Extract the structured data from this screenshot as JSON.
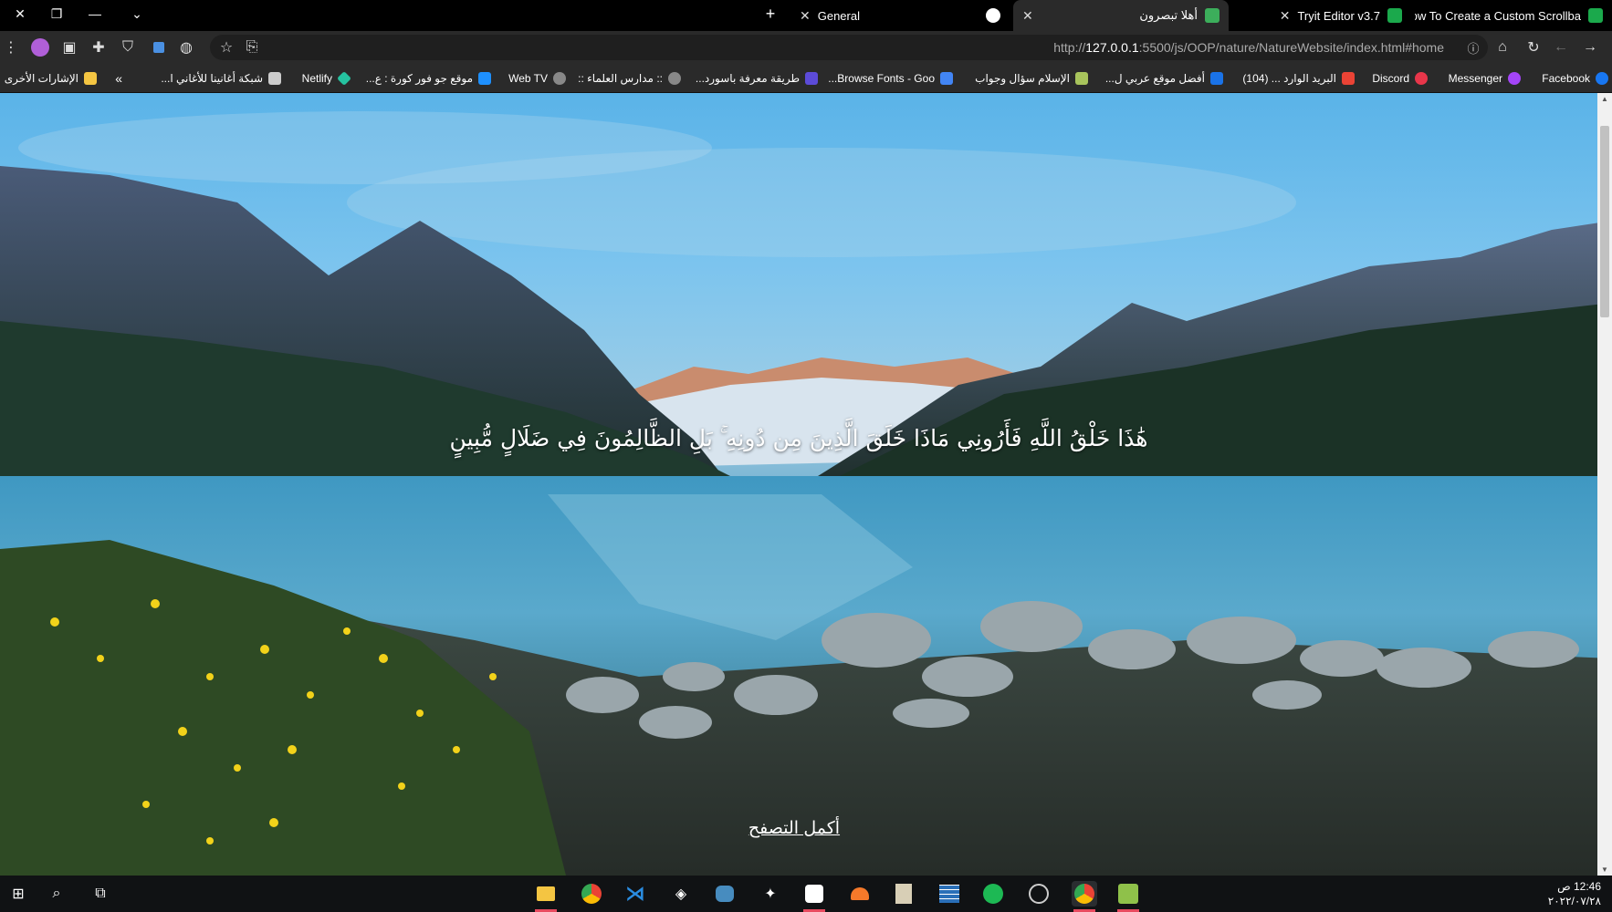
{
  "tabs": [
    {
      "title": "How To Create a Custom Scrollba",
      "favicon": "w-green-icon",
      "color": "#1ba94c"
    },
    {
      "title": "Tryit Editor v3.7",
      "favicon": "w-green-icon",
      "color": "#1ba94c"
    },
    {
      "title": "أهلا تبصرون",
      "favicon": "tree-icon",
      "color": "#3cae5b",
      "active": true
    },
    {
      "title": "General",
      "favicon": "github-icon",
      "color": "#ffffff"
    }
  ],
  "toolbar": {
    "url_prefix": "http://",
    "url_host": "127.0.0.1",
    "url_rest": ":5500/js/OOP/nature/NatureWebsite/index.html#home"
  },
  "bookmarks": [
    {
      "label": "Facebook",
      "icon": "facebook-icon",
      "color": "#1877f2"
    },
    {
      "label": "Messenger",
      "icon": "messenger-icon",
      "color": "#a445f8"
    },
    {
      "label": "Discord",
      "icon": "discord-icon",
      "color": "#e8364a"
    },
    {
      "label": "البريد الوارد ... (104)",
      "icon": "gmail-icon",
      "color": "#ea4335"
    },
    {
      "label": "أفضل موقع عربي ل...",
      "icon": "h-icon",
      "color": "#1a73e8"
    },
    {
      "label": "الإسلام سؤال وجواب",
      "icon": "islamqa-icon",
      "color": "#a8c45c"
    },
    {
      "label": "Browse Fonts - Goo...",
      "icon": "google-fonts-icon",
      "color": "#4285f4"
    },
    {
      "label": "طريقة معرفة باسورد...",
      "icon": "three-icon",
      "color": "#5c4bd8"
    },
    {
      "label": ":: مدارس العلماء ::",
      "icon": "globe-icon",
      "color": "#888888"
    },
    {
      "label": "Web TV",
      "icon": "globe-icon",
      "color": "#888888"
    },
    {
      "label": "موقع جو فور كورة : ع...",
      "icon": "infinity-icon",
      "color": "#1e90ff"
    },
    {
      "label": "Netlify",
      "icon": "netlify-icon",
      "color": "#25c2a0"
    },
    {
      "label": "شبكة أغانينا للأغاني ا...",
      "icon": "speaker-icon",
      "color": "#cccccc"
    }
  ],
  "bookmarks_more": "»",
  "other_bookmarks": "الإشارات الأخرى",
  "hero": {
    "verse": "هَٰذَا خَلْقُ اللَّهِ فَأَرُونِي مَاذَا خَلَقَ الَّذِينَ مِن دُونِهِ ۚ بَلِ الظَّالِمُونَ فِي ضَلَالٍ مُّبِينٍ",
    "continue_link": "أكمل التصفح"
  },
  "taskbar": {
    "apps": [
      {
        "icon": "file-explorer-icon",
        "color": "#f4c542"
      },
      {
        "icon": "chrome-icon",
        "color": "#4285f4"
      },
      {
        "icon": "vscode-icon",
        "color": "#2a8ce0"
      },
      {
        "icon": "unity-icon",
        "color": "#ffffff"
      },
      {
        "icon": "godot-icon",
        "color": "#478cbf"
      },
      {
        "icon": "game-icon",
        "color": "#888888"
      },
      {
        "icon": "aseprite-icon",
        "color": "#e8364a"
      },
      {
        "icon": "blender-icon",
        "color": "#f5792a"
      },
      {
        "icon": "notes-icon",
        "color": "#d8cfb6"
      },
      {
        "icon": "grid-app-icon",
        "color": "#2a6fb8"
      },
      {
        "icon": "spotify-icon",
        "color": "#1db954"
      },
      {
        "icon": "obs-icon",
        "color": "#cccccc"
      },
      {
        "icon": "chrome-profile-icon",
        "color": "#e84a5f"
      },
      {
        "icon": "tree-app-icon",
        "color": "#8fc14a"
      }
    ],
    "time": "12:46 ص",
    "date": "٢٠٢٢/٠٧/٢٨"
  }
}
